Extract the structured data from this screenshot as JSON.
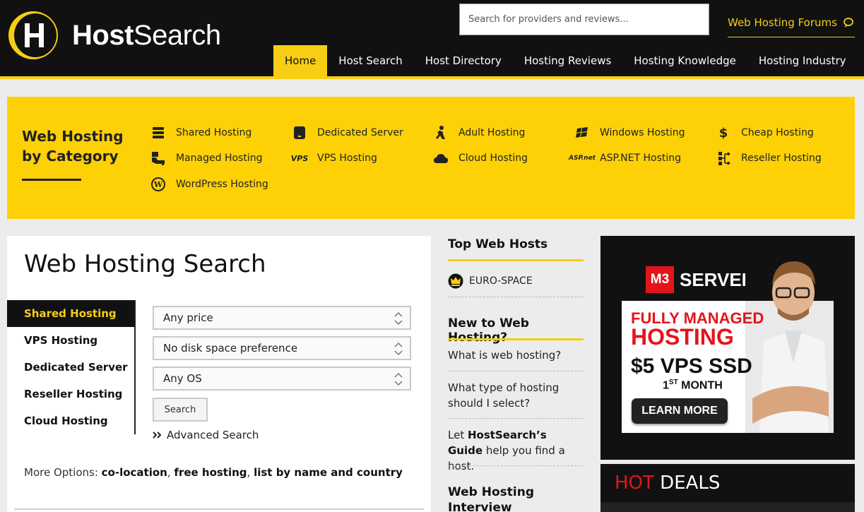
{
  "header": {
    "logo_letter": "H",
    "logo_brand_bold": "Host",
    "logo_brand_rest": "Search",
    "search_placeholder": "Search for providers and reviews...",
    "forums_label": "Web Hosting Forums"
  },
  "nav": {
    "items": [
      {
        "label": "Home"
      },
      {
        "label": "Host Search"
      },
      {
        "label": "Host Directory"
      },
      {
        "label": "Hosting Reviews"
      },
      {
        "label": "Hosting Knowledge"
      },
      {
        "label": "Hosting Industry"
      }
    ],
    "active": "Home"
  },
  "categories": {
    "title": "Web Hosting by Category",
    "items": [
      {
        "label": "Shared Hosting",
        "icon": "server-stack-icon"
      },
      {
        "label": "Managed Hosting",
        "icon": "managed-hand-icon"
      },
      {
        "label": "WordPress Hosting",
        "icon": "wordpress-icon"
      },
      {
        "label": "Dedicated Server",
        "icon": "dedicated-server-icon"
      },
      {
        "label": "VPS Hosting",
        "icon": "vps-icon",
        "icon_text": "VPS"
      },
      {
        "label": "Adult Hosting",
        "icon": "adult-figure-icon"
      },
      {
        "label": "Cloud Hosting",
        "icon": "cloud-icon"
      },
      {
        "label": "Windows Hosting",
        "icon": "windows-icon"
      },
      {
        "label": "ASP.NET Hosting",
        "icon": "aspnet-icon",
        "icon_text": "ASP.net"
      },
      {
        "label": "Cheap Hosting",
        "icon": "dollar-icon",
        "icon_text": "$"
      },
      {
        "label": "Reseller Hosting",
        "icon": "reseller-network-icon"
      }
    ]
  },
  "search_panel": {
    "title": "Web Hosting Search",
    "tabs": [
      "Shared Hosting",
      "VPS Hosting",
      "Dedicated Server",
      "Reseller Hosting",
      "Cloud Hosting"
    ],
    "active_tab": "Shared Hosting",
    "selects": [
      {
        "value": "Any price"
      },
      {
        "value": "No disk space preference"
      },
      {
        "value": "Any OS"
      }
    ],
    "search_button": "Search",
    "advanced_search": "Advanced Search",
    "more_options_label": "More Options:",
    "more_options_links": [
      "co-location",
      "free hosting",
      "list by name and country"
    ]
  },
  "sidebar": {
    "top_hosts_title": "Top Web Hosts",
    "top_hosts": [
      {
        "name": "EURO-SPACE"
      }
    ],
    "new_title": "New to Web Hosting?",
    "new_links": [
      {
        "text": "What is web hosting?"
      },
      {
        "text": "What type of hosting should I select?"
      }
    ],
    "guide_prefix": "Let",
    "guide_bold": "HostSearch’s Guide",
    "guide_suffix": "help you find a host.",
    "interview_title": "Web Hosting Interview"
  },
  "ad": {
    "brand_mark": "M3",
    "brand_name": "SERVER",
    "line1": "FULLY MANAGED",
    "line2": "HOSTING",
    "line3": "$5 VPS SSD",
    "line4_number": "1",
    "line4_sup": "ST",
    "line4_rest": " MONTH",
    "cta": "LEARN MORE"
  },
  "deals": {
    "hot": "HOT",
    "rest": " DEALS"
  },
  "colors": {
    "brand_yellow": "#f7ce13",
    "header_black": "#111111",
    "accent_red": "#e5141c"
  }
}
